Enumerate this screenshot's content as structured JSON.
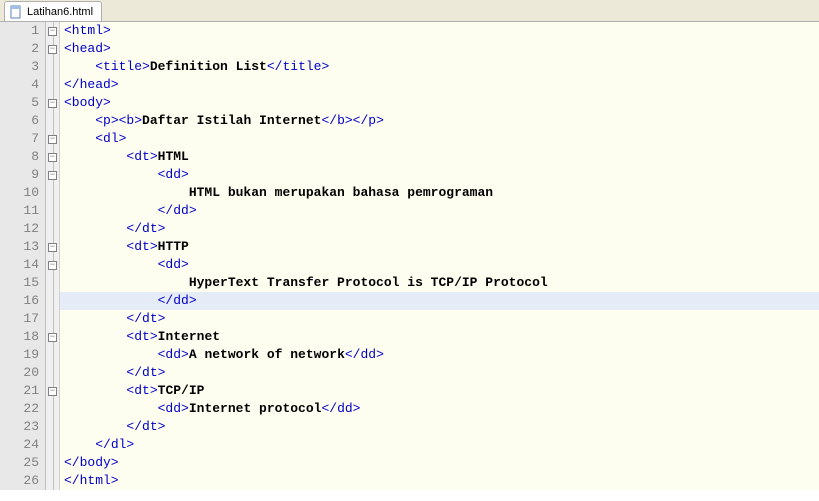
{
  "tab": {
    "filename": "Latihan6.html"
  },
  "lines": [
    {
      "n": "1",
      "fold": "box",
      "html": "<span class='tag'>&lt;html&gt;</span>"
    },
    {
      "n": "2",
      "fold": "box",
      "html": "<span class='tag'>&lt;head&gt;</span>"
    },
    {
      "n": "3",
      "fold": "line",
      "html": "    <span class='tag'>&lt;title&gt;</span><span class='txt'>Definition List</span><span class='tag'>&lt;/title&gt;</span>"
    },
    {
      "n": "4",
      "fold": "end",
      "html": "<span class='tag'>&lt;/head&gt;</span>"
    },
    {
      "n": "5",
      "fold": "box",
      "html": "<span class='tag'>&lt;body&gt;</span>"
    },
    {
      "n": "6",
      "fold": "line",
      "html": "    <span class='tag'>&lt;p&gt;&lt;b&gt;</span><span class='txt'>Daftar Istilah Internet</span><span class='tag'>&lt;/b&gt;&lt;/p&gt;</span>"
    },
    {
      "n": "7",
      "fold": "box",
      "html": "    <span class='tag'>&lt;dl&gt;</span>"
    },
    {
      "n": "8",
      "fold": "box",
      "html": "        <span class='tag'>&lt;dt&gt;</span><span class='txt'>HTML</span>"
    },
    {
      "n": "9",
      "fold": "box",
      "html": "            <span class='tag'>&lt;dd&gt;</span>"
    },
    {
      "n": "10",
      "fold": "line",
      "html": "                <span class='txt'>HTML bukan merupakan bahasa pemrograman</span>"
    },
    {
      "n": "11",
      "fold": "end",
      "html": "            <span class='tag'>&lt;/dd&gt;</span>"
    },
    {
      "n": "12",
      "fold": "end",
      "html": "        <span class='tag'>&lt;/dt&gt;</span>"
    },
    {
      "n": "13",
      "fold": "box",
      "html": "        <span class='tag'>&lt;dt&gt;</span><span class='txt'>HTTP</span>"
    },
    {
      "n": "14",
      "fold": "box",
      "html": "            <span class='tag'>&lt;dd&gt;</span>"
    },
    {
      "n": "15",
      "fold": "line",
      "html": "                <span class='txt'>HyperText Transfer Protocol is TCP/IP Protocol</span>"
    },
    {
      "n": "16",
      "fold": "end",
      "highlight": true,
      "html": "            <span class='tag'>&lt;/dd&gt;</span>"
    },
    {
      "n": "17",
      "fold": "end",
      "html": "        <span class='tag'>&lt;/dt&gt;</span>"
    },
    {
      "n": "18",
      "fold": "box",
      "html": "        <span class='tag'>&lt;dt&gt;</span><span class='txt'>Internet</span>"
    },
    {
      "n": "19",
      "fold": "line",
      "html": "            <span class='tag'>&lt;dd&gt;</span><span class='txt'>A network of network</span><span class='tag'>&lt;/dd&gt;</span>"
    },
    {
      "n": "20",
      "fold": "end",
      "html": "        <span class='tag'>&lt;/dt&gt;</span>"
    },
    {
      "n": "21",
      "fold": "box",
      "html": "        <span class='tag'>&lt;dt&gt;</span><span class='txt'>TCP/IP</span>"
    },
    {
      "n": "22",
      "fold": "line",
      "html": "            <span class='tag'>&lt;dd&gt;</span><span class='txt'>Internet protocol</span><span class='tag'>&lt;/dd&gt;</span>"
    },
    {
      "n": "23",
      "fold": "end",
      "html": "        <span class='tag'>&lt;/dt&gt;</span>"
    },
    {
      "n": "24",
      "fold": "end",
      "html": "    <span class='tag'>&lt;/dl&gt;</span>"
    },
    {
      "n": "25",
      "fold": "end",
      "html": "<span class='tag'>&lt;/body&gt;</span>"
    },
    {
      "n": "26",
      "fold": "end",
      "html": "<span class='tag'>&lt;/html&gt;</span>"
    }
  ]
}
